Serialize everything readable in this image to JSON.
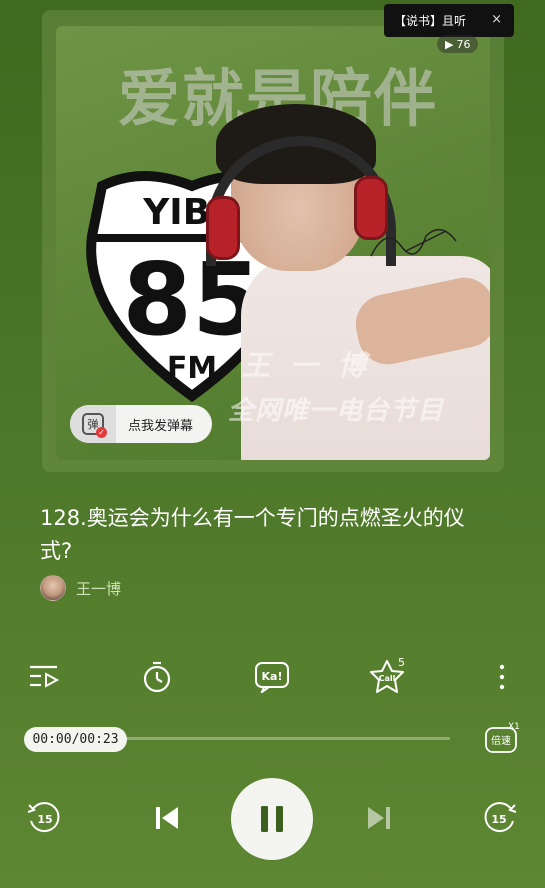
{
  "cover": {
    "headline": "爱就是陪伴",
    "shield_top": "YIBO",
    "shield_number": "85",
    "shield_bottom": "FM",
    "name": "王一博",
    "tagline": "全网唯一电台节目"
  },
  "danmaku": {
    "icon_char": "弹",
    "label": "点我发弹幕"
  },
  "tip": {
    "text": "【说书】且听",
    "close": "×"
  },
  "play_count": "76",
  "episode": {
    "title": "128.奥运会为什么有一个专门的点燃圣火的仪式?"
  },
  "author": {
    "name": "王一博"
  },
  "tools": {
    "playlist_icon": "playlist-icon",
    "timer_icon": "timer-icon",
    "ka_label": "Ka!",
    "call_label": "Call",
    "call_count": "5",
    "more_icon": "more-vertical-icon"
  },
  "progress": {
    "time": "00:00/00:23",
    "fraction": 0.0
  },
  "speed": {
    "label": "倍速",
    "multiplier": "X1"
  },
  "controls": {
    "rewind_label": "15",
    "forward_label": "15",
    "play_state": "pause-icon"
  },
  "colors": {
    "background": "#4a7527",
    "accent": "#f4f4f1",
    "author": "#cfe2b5"
  }
}
